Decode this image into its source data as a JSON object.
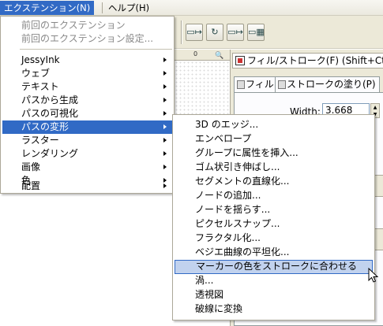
{
  "menubar": {
    "extensions": "エクステンション(N)",
    "help": "ヘルプ(H)"
  },
  "toolbar": {
    "buttons": [
      "▭↦",
      "↻",
      "▭↦",
      "▭▦"
    ]
  },
  "ruler": {
    "tick": "0",
    "zoom_glyph": "🔍"
  },
  "fill_panel": {
    "title": "フィル/ストローク(F) (Shift+Ctrl+F)",
    "tab_fill": "フィル",
    "tab_stroke": "ストロークの塗り(P)",
    "width_label": "Width:",
    "width_value": "3.668"
  },
  "main_menu": {
    "items": [
      {
        "label": "前回のエクステンション",
        "disabled": true
      },
      {
        "label": "前回のエクステンション設定...",
        "disabled": true
      },
      {
        "label": "JessyInk",
        "submenu": true
      },
      {
        "label": "ウェブ",
        "submenu": true
      },
      {
        "label": "テキスト",
        "submenu": true
      },
      {
        "label": "パスから生成",
        "submenu": true
      },
      {
        "label": "パスの可視化",
        "submenu": true
      },
      {
        "label": "パスの変形",
        "submenu": true,
        "active": true
      },
      {
        "label": "ラスター",
        "submenu": true
      },
      {
        "label": "レンダリング",
        "submenu": true
      },
      {
        "label": "画像",
        "submenu": true
      },
      {
        "label": "色",
        "submenu": true
      },
      {
        "label": "配置",
        "submenu": true
      }
    ]
  },
  "sub_menu": {
    "items": [
      {
        "label": "3D のエッジ..."
      },
      {
        "label": "エンベロープ"
      },
      {
        "label": "グループに属性を挿入..."
      },
      {
        "label": "ゴム状引き伸ばし..."
      },
      {
        "label": "セグメントの直線化..."
      },
      {
        "label": "ノードの追加..."
      },
      {
        "label": "ノードを揺らす..."
      },
      {
        "label": "ピクセルスナップ..."
      },
      {
        "label": "フラクタル化..."
      },
      {
        "label": "ベジエ曲線の平坦化..."
      },
      {
        "label": "マーカーの色をストロークに合わせる",
        "hover": true
      },
      {
        "label": "渦..."
      },
      {
        "label": "透視図"
      },
      {
        "label": "破線に変換"
      }
    ]
  }
}
